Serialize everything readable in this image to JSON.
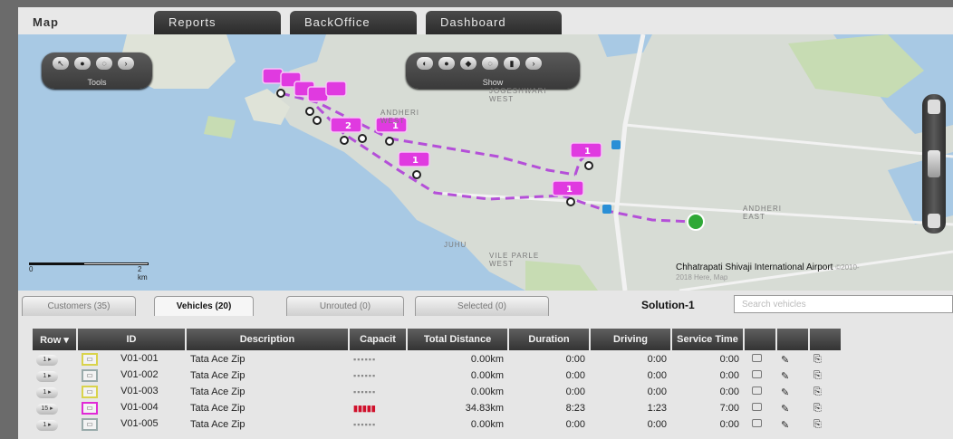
{
  "tabs": [
    "Map",
    "Reports",
    "BackOffice",
    "Dashboard"
  ],
  "map": {
    "tools_label": "Tools",
    "show_label": "Show",
    "places": [
      "JOGESHWARI WEST",
      "ANDHERI WEST",
      "ANDHERI EAST",
      "JUHU",
      "VILE PARLE WEST"
    ],
    "scale": {
      "start": "0",
      "end": "2 km"
    },
    "airport_label": "Chhatrapati Shivaji International Airport",
    "copyright": "©2010-2018 Here, Map"
  },
  "panel": {
    "tabs": [
      "Customers (35)",
      "Vehicles (20)",
      "Unrouted (0)",
      "Selected (0)"
    ],
    "solution": "Solution-1",
    "search_placeholder": "Search vehicles",
    "columns": [
      "Row",
      "ID",
      "Description",
      "Capacit",
      "Total Distance",
      "Duration",
      "Driving",
      "Service Time"
    ],
    "rows": [
      {
        "btn": "1 ▸",
        "id": "V01-001",
        "desc": "Tata Ace Zip",
        "cap": "▪▪▪▪▪▪",
        "dist": "0.00km",
        "dur": "0:00",
        "drive": "0:00",
        "service": "0:00"
      },
      {
        "btn": "1 ▸",
        "id": "V01-002",
        "desc": "Tata Ace Zip",
        "cap": "▪▪▪▪▪▪",
        "dist": "0.00km",
        "dur": "0:00",
        "drive": "0:00",
        "service": "0:00"
      },
      {
        "btn": "1 ▸",
        "id": "V01-003",
        "desc": "Tata Ace Zip",
        "cap": "▪▪▪▪▪▪",
        "dist": "0.00km",
        "dur": "0:00",
        "drive": "0:00",
        "service": "0:00"
      },
      {
        "btn": "15 ▸",
        "id": "V01-004",
        "desc": "Tata Ace Zip",
        "cap": "▮▮▮▮▮",
        "dist": "34.83km",
        "dur": "8:23",
        "drive": "1:23",
        "service": "7:00"
      },
      {
        "btn": "1 ▸",
        "id": "V01-005",
        "desc": "Tata Ace Zip",
        "cap": "▪▪▪▪▪▪",
        "dist": "0.00km",
        "dur": "0:00",
        "drive": "0:00",
        "service": "0:00"
      }
    ]
  },
  "colors": {
    "route": "#b44fd8",
    "stop_marker": "#e03ae0",
    "depot": "#2fa836",
    "water": "#a8c9e4",
    "land": "#d9dcd3"
  }
}
